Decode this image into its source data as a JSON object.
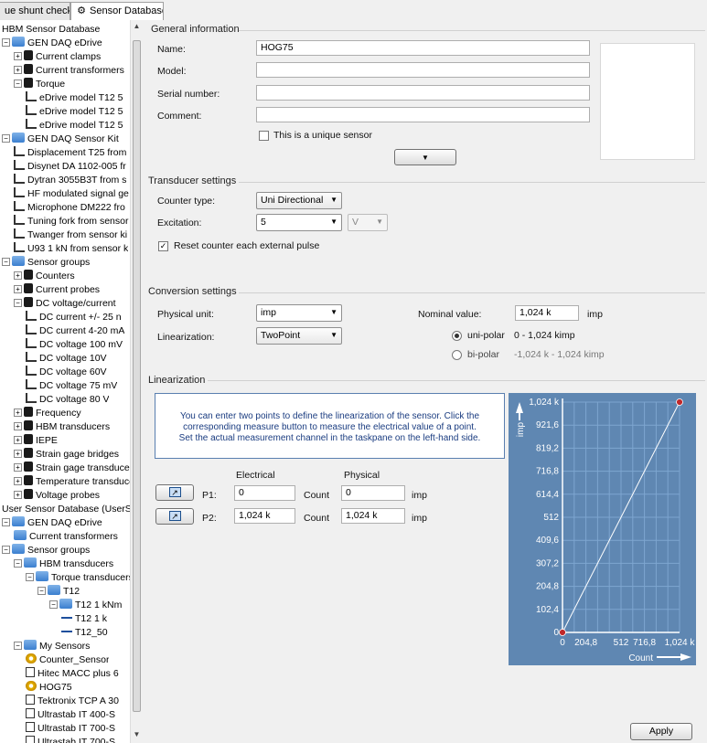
{
  "tabs": [
    {
      "label": "ue shunt check",
      "active": false
    },
    {
      "label": "Sensor Database",
      "active": true
    }
  ],
  "tree": [
    {
      "d": 0,
      "exp": "",
      "ic": "",
      "label": "HBM Sensor Database"
    },
    {
      "d": 0,
      "exp": "-",
      "ic": "fold",
      "label": "GEN DAQ eDrive"
    },
    {
      "d": 1,
      "exp": "+",
      "ic": "lock",
      "label": "Current clamps"
    },
    {
      "d": 1,
      "exp": "+",
      "ic": "lock",
      "label": "Current transformers"
    },
    {
      "d": 1,
      "exp": "-",
      "ic": "lock",
      "label": "Torque"
    },
    {
      "d": 2,
      "exp": "",
      "ic": "probe",
      "label": "eDrive model T12 5"
    },
    {
      "d": 2,
      "exp": "",
      "ic": "probe",
      "label": "eDrive model T12 5"
    },
    {
      "d": 2,
      "exp": "",
      "ic": "probe",
      "label": "eDrive model T12 5"
    },
    {
      "d": 0,
      "exp": "-",
      "ic": "fold",
      "label": "GEN DAQ Sensor Kit"
    },
    {
      "d": 1,
      "exp": "",
      "ic": "probe",
      "label": "Displacement T25 from"
    },
    {
      "d": 1,
      "exp": "",
      "ic": "probe",
      "label": "Disynet DA 1102-005 fr"
    },
    {
      "d": 1,
      "exp": "",
      "ic": "probe",
      "label": "Dytran 3055B3T from s"
    },
    {
      "d": 1,
      "exp": "",
      "ic": "probe",
      "label": "HF modulated signal ge"
    },
    {
      "d": 1,
      "exp": "",
      "ic": "probe",
      "label": "Microphone DM222 fro"
    },
    {
      "d": 1,
      "exp": "",
      "ic": "probe",
      "label": "Tuning fork from sensor"
    },
    {
      "d": 1,
      "exp": "",
      "ic": "probe",
      "label": "Twanger from sensor ki"
    },
    {
      "d": 1,
      "exp": "",
      "ic": "probe",
      "label": "U93 1 kN from sensor k"
    },
    {
      "d": 0,
      "exp": "-",
      "ic": "fold",
      "label": "Sensor groups"
    },
    {
      "d": 1,
      "exp": "+",
      "ic": "lock",
      "label": "Counters"
    },
    {
      "d": 1,
      "exp": "+",
      "ic": "lock",
      "label": "Current probes"
    },
    {
      "d": 1,
      "exp": "-",
      "ic": "lock",
      "label": "DC voltage/current"
    },
    {
      "d": 2,
      "exp": "",
      "ic": "probe",
      "label": "DC current +/- 25 n"
    },
    {
      "d": 2,
      "exp": "",
      "ic": "probe",
      "label": "DC current 4-20 mA"
    },
    {
      "d": 2,
      "exp": "",
      "ic": "probe",
      "label": "DC voltage 100 mV"
    },
    {
      "d": 2,
      "exp": "",
      "ic": "probe",
      "label": "DC voltage 10V"
    },
    {
      "d": 2,
      "exp": "",
      "ic": "probe",
      "label": "DC voltage 60V"
    },
    {
      "d": 2,
      "exp": "",
      "ic": "probe",
      "label": "DC voltage 75 mV"
    },
    {
      "d": 2,
      "exp": "",
      "ic": "probe",
      "label": "DC voltage 80 V"
    },
    {
      "d": 1,
      "exp": "+",
      "ic": "lock",
      "label": "Frequency"
    },
    {
      "d": 1,
      "exp": "+",
      "ic": "lock",
      "label": "HBM transducers"
    },
    {
      "d": 1,
      "exp": "+",
      "ic": "lock",
      "label": "IEPE"
    },
    {
      "d": 1,
      "exp": "+",
      "ic": "lock",
      "label": "Strain gage bridges"
    },
    {
      "d": 1,
      "exp": "+",
      "ic": "lock",
      "label": "Strain gage transducers"
    },
    {
      "d": 1,
      "exp": "+",
      "ic": "lock",
      "label": "Temperature transduce"
    },
    {
      "d": 1,
      "exp": "+",
      "ic": "lock",
      "label": "Voltage probes"
    },
    {
      "d": 0,
      "exp": "",
      "ic": "",
      "label": "User Sensor Database  (UserSe"
    },
    {
      "d": 0,
      "exp": "-",
      "ic": "fold",
      "label": "GEN DAQ eDrive"
    },
    {
      "d": 1,
      "exp": "",
      "ic": "fold",
      "label": "Current transformers"
    },
    {
      "d": 0,
      "exp": "-",
      "ic": "fold",
      "label": "Sensor groups"
    },
    {
      "d": 1,
      "exp": "-",
      "ic": "fold",
      "label": "HBM transducers"
    },
    {
      "d": 2,
      "exp": "-",
      "ic": "fold",
      "label": "Torque transducers"
    },
    {
      "d": 3,
      "exp": "-",
      "ic": "fold",
      "label": "T12"
    },
    {
      "d": 4,
      "exp": "-",
      "ic": "fold",
      "label": "T12 1 kNm"
    },
    {
      "d": 5,
      "exp": "",
      "ic": "wave",
      "label": "T12 1 k"
    },
    {
      "d": 5,
      "exp": "",
      "ic": "wave",
      "label": "T12_50"
    },
    {
      "d": 1,
      "exp": "-",
      "ic": "fold",
      "label": "My Sensors"
    },
    {
      "d": 2,
      "exp": "",
      "ic": "gearic",
      "label": "Counter_Sensor"
    },
    {
      "d": 2,
      "exp": "",
      "ic": "sq",
      "label": "Hitec MACC plus 6"
    },
    {
      "d": 2,
      "exp": "",
      "ic": "gearic",
      "label": "HOG75"
    },
    {
      "d": 2,
      "exp": "",
      "ic": "sq",
      "label": "Tektronix TCP A 30"
    },
    {
      "d": 2,
      "exp": "",
      "ic": "sq",
      "label": "Ultrastab IT 400-S"
    },
    {
      "d": 2,
      "exp": "",
      "ic": "sq",
      "label": "Ultrastab IT 700-S"
    },
    {
      "d": 2,
      "exp": "",
      "ic": "sq",
      "label": "Ultrastab IT 700-S"
    }
  ],
  "general": {
    "title": "General information",
    "name_label": "Name:",
    "name_value": "HOG75",
    "model_label": "Model:",
    "model_value": "",
    "serial_label": "Serial number:",
    "serial_value": "",
    "comment_label": "Comment:",
    "comment_value": "",
    "unique_label": "This is a unique sensor",
    "unique_checked": false
  },
  "transducer": {
    "title": "Transducer settings",
    "counter_label": "Counter type:",
    "counter_value": "Uni Directional",
    "excitation_label": "Excitation:",
    "excitation_value": "5",
    "excitation_unit": "V",
    "reset_label": "Reset counter each external pulse",
    "reset_checked": true
  },
  "conversion": {
    "title": "Conversion settings",
    "unit_label": "Physical unit:",
    "unit_value": "imp",
    "lin_label": "Linearization:",
    "lin_value": "TwoPoint",
    "nominal_label": "Nominal value:",
    "nominal_value": "1,024 k",
    "nominal_unit": "imp",
    "unipolar_label": "uni-polar",
    "unipolar_range": "0 - 1,024 kimp",
    "bipolar_label": "bi-polar",
    "bipolar_range": "-1,024 k - 1,024 kimp"
  },
  "linearization": {
    "title": "Linearization",
    "info": "You can enter two points to define the linearization of the sensor. Click the corresponding measure button to measure the electrical value of a point. Set the actual measurement channel in the taskpane on the left-hand side.",
    "electrical_header": "Electrical",
    "physical_header": "Physical",
    "p1_label": "P1:",
    "p1_electrical": "0",
    "p1_count": "Count",
    "p1_physical": "0",
    "p1_unit": "imp",
    "p2_label": "P2:",
    "p2_electrical": "1,024 k",
    "p2_count": "Count",
    "p2_physical": "1,024 k",
    "p2_unit": "imp"
  },
  "apply_label": "Apply",
  "colors": {
    "chart_bg": "#5f87b2",
    "grid": "#7ea6d0",
    "point": "#c0282a"
  },
  "chart_data": {
    "type": "line",
    "xlabel": "Count",
    "ylabel": "imp",
    "x_ticks": [
      "0",
      "204,8",
      "512",
      "716,8",
      "1,024 k"
    ],
    "x_tick_values": [
      0,
      204.8,
      512,
      716.8,
      1024
    ],
    "y_ticks": [
      "0",
      "102,4",
      "204,8",
      "307,2",
      "409,6",
      "512",
      "614,4",
      "716,8",
      "819,2",
      "921,6",
      "1,024 k"
    ],
    "y_tick_values": [
      0,
      102.4,
      204.8,
      307.2,
      409.6,
      512,
      614.4,
      716.8,
      819.2,
      921.6,
      1024
    ],
    "xlim": [
      0,
      1024
    ],
    "ylim": [
      0,
      1024
    ],
    "grid": true,
    "series": [
      {
        "x": [
          0,
          1024
        ],
        "y": [
          0,
          1024
        ]
      }
    ]
  }
}
